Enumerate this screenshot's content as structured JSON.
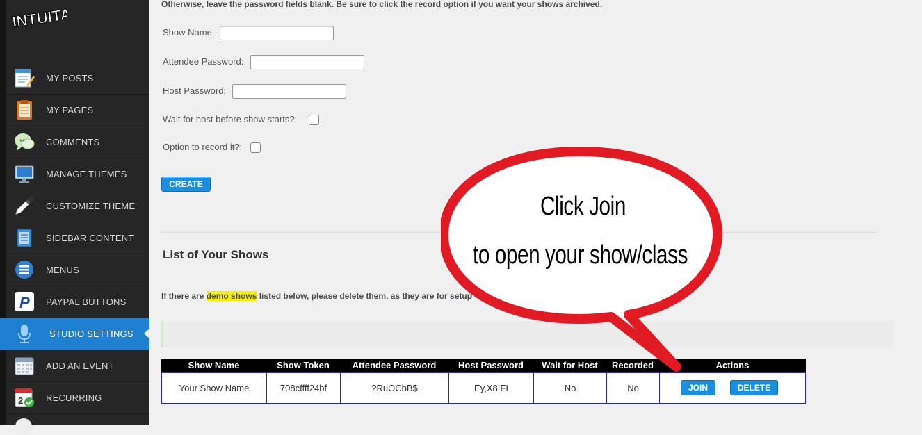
{
  "brand": {
    "logo_text": "INTUITALKS"
  },
  "sidebar": {
    "items": [
      {
        "label": "MY POSTS",
        "icon": "edit-post-icon"
      },
      {
        "label": "MY PAGES",
        "icon": "clipboard-icon"
      },
      {
        "label": "COMMENTS",
        "icon": "comments-icon"
      },
      {
        "label": "MANAGE THEMES",
        "icon": "monitor-icon"
      },
      {
        "label": "CUSTOMIZE THEME",
        "icon": "eyedropper-icon"
      },
      {
        "label": "SIDEBAR CONTENT",
        "icon": "sidebar-icon"
      },
      {
        "label": "MENUS",
        "icon": "menu-icon"
      },
      {
        "label": "PAYPAL BUTTONS",
        "icon": "paypal-icon"
      },
      {
        "label": "STUDIO SETTINGS",
        "icon": "microphone-icon",
        "active": true
      },
      {
        "label": "ADD AN EVENT",
        "icon": "calendar-icon"
      },
      {
        "label": "RECURRING",
        "icon": "calendar-recurring-icon"
      }
    ]
  },
  "form": {
    "intro": "Otherwise, leave the password fields blank. Be sure to click the record option if you want your shows archived.",
    "show_name_label": "Show Name:",
    "show_name_value": "",
    "attendee_password_label": "Attendee Password:",
    "attendee_password_value": "",
    "host_password_label": "Host Password:",
    "host_password_value": "",
    "wait_for_host_label": "Wait for host before show starts?:",
    "record_label": "Option to record it?:",
    "create_button": "CREATE"
  },
  "shows": {
    "title": "List of Your Shows",
    "notice_prefix": "If there are ",
    "notice_highlight": "demo shows",
    "notice_suffix": " listed below, please delete them, as they are for setup",
    "columns": [
      "Show Name",
      "Show Token",
      "Attendee Password",
      "Host Password",
      "Wait for Host",
      "Recorded",
      "Actions"
    ],
    "rows": [
      {
        "show_name": "Your Show Name",
        "show_token": "708cffff24bf",
        "attendee_password": "?RuOCbB$",
        "host_password": "Ey,X8!FI",
        "wait_for_host": "No",
        "recorded": "No",
        "join_label": "JOIN",
        "delete_label": "DELETE"
      }
    ]
  },
  "callout": {
    "line1": "Click Join",
    "line2": "to open your show/class",
    "colors": {
      "ring": "#e01b24",
      "fill": "#ffffff"
    }
  },
  "colors": {
    "sidebar_bg": "#262626",
    "accent": "#1f7fd0",
    "button": "#1a8fe0"
  }
}
